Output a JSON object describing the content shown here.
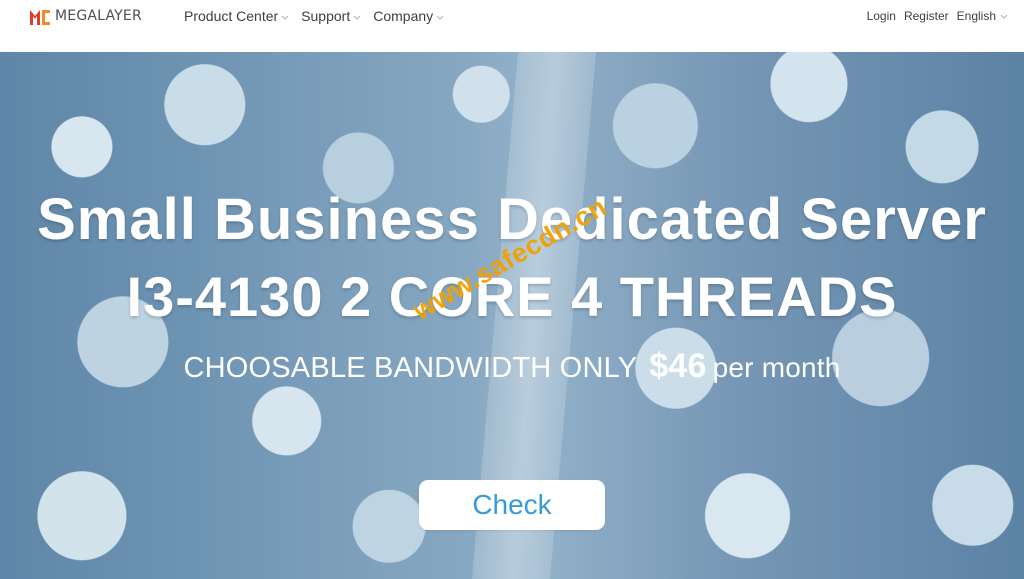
{
  "brand": {
    "name": "MEGALAYER",
    "logo_colors": {
      "red": "#e23b2e",
      "orange": "#f08a2a"
    }
  },
  "nav": {
    "items": [
      {
        "label": "Product Center"
      },
      {
        "label": "Support"
      },
      {
        "label": "Company"
      }
    ],
    "login": "Login",
    "register": "Register",
    "language": "English"
  },
  "hero": {
    "title_line1": "Small Business Dedicated Server",
    "title_line2": "I3-4130 2 CORE 4 THREADS",
    "sub_prefix": "CHOOSABLE BANDWIDTH ONLY",
    "price": "$46",
    "sub_suffix": "per month",
    "cta": "Check",
    "watermark": "www.safecdn.cn"
  }
}
